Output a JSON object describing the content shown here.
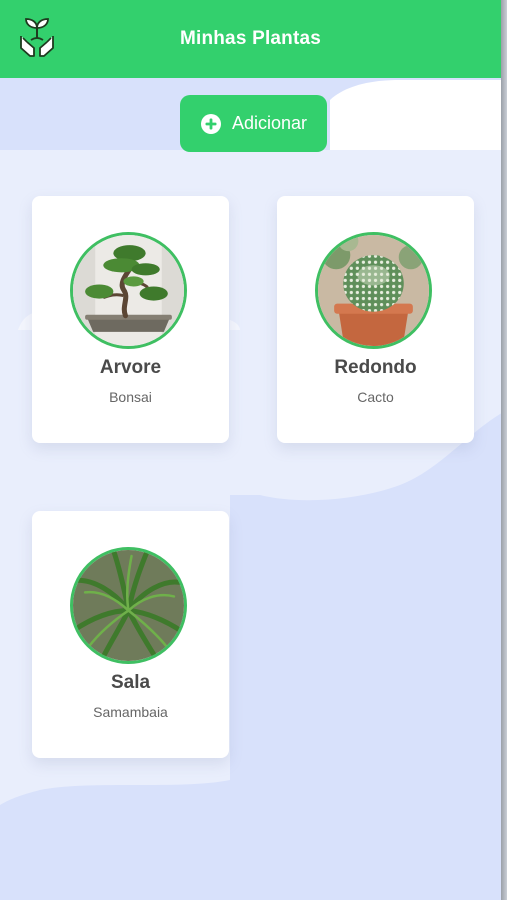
{
  "header": {
    "title": "Minhas Plantas",
    "logo_icon": "hands-holding-sprout-icon",
    "color": "#33d06d"
  },
  "add_button": {
    "label": "Adicionar",
    "icon": "plus-circle-icon"
  },
  "plants": [
    {
      "name": "Arvore",
      "species": "Bonsai",
      "photo": "bonsai-photo"
    },
    {
      "name": "Redondo",
      "species": "Cacto",
      "photo": "cactus-photo"
    },
    {
      "name": "Sala",
      "species": "Samambaia",
      "photo": "fern-photo"
    }
  ],
  "colors": {
    "accent": "#33d06d",
    "photo_ring": "#3fbf62",
    "background": "#dfe6fb"
  }
}
